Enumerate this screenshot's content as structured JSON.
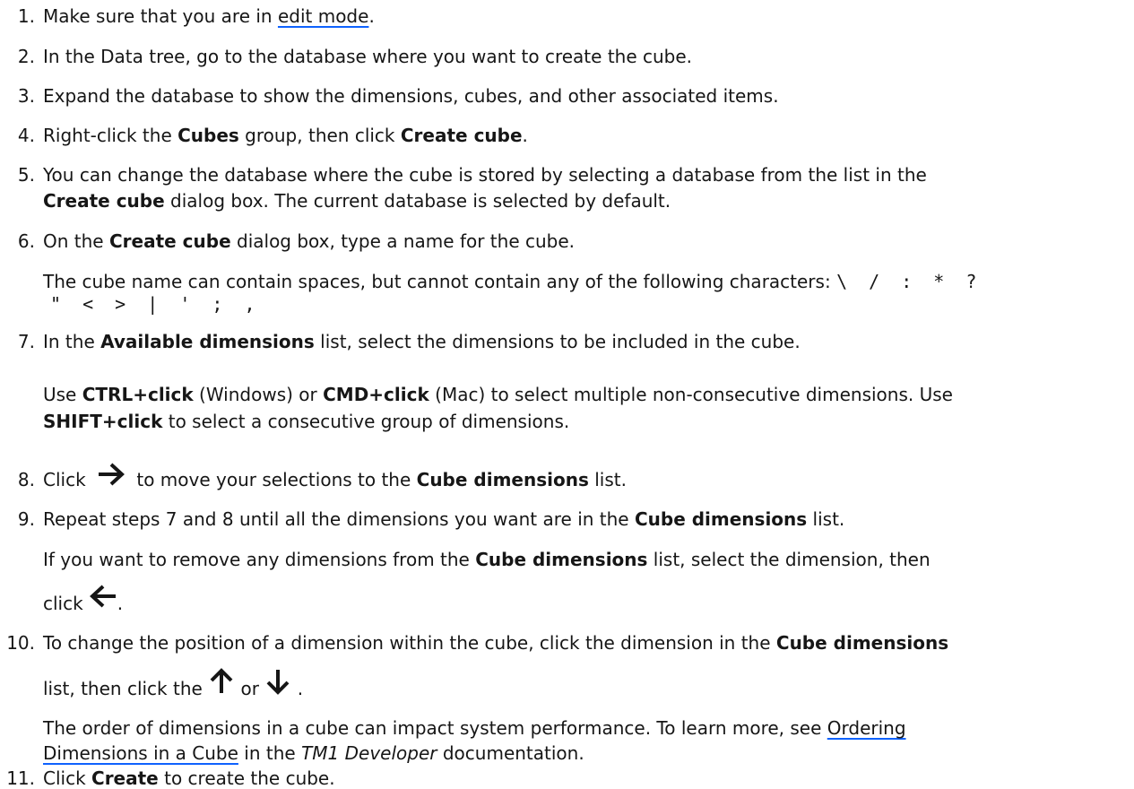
{
  "steps": [
    {
      "num": "1.",
      "pre": "Make sure that you are in ",
      "link": "edit mode",
      "post": "."
    },
    {
      "num": "2.",
      "text": "In the Data tree, go to the database where you want to create the cube."
    },
    {
      "num": "3.",
      "text": "Expand the database to show the dimensions, cubes, and other associated items."
    },
    {
      "num": "4.",
      "a": "Right-click the ",
      "b1": "Cubes",
      "c": " group, then click ",
      "b2": "Create cube",
      "d": "."
    },
    {
      "num": "5.",
      "line1": "You can change the database where the cube is stored by selecting a database from the list in the",
      "b1": "Create cube",
      "line2": " dialog box. The current database is selected by default."
    },
    {
      "num": "6.",
      "a": "On the ",
      "b1": "Create cube",
      "c": " dialog box, type a name for the cube.",
      "note_line1": "The cube name can contain spaces, but cannot contain any of the following characters: ",
      "note_chars1": "\\ / : * ?",
      "note_chars2": "\" < > | ' ; ,"
    },
    {
      "num": "7.",
      "a": "In the ",
      "b1": "Available dimensions",
      "c": " list, select the dimensions to be included in the cube.",
      "p_use": "Use ",
      "p_b1": "CTRL+click",
      "p_win": " (Windows) or ",
      "p_b2": "CMD+click",
      "p_rest": " (Mac) to select multiple non-consecutive dimensions. Use",
      "p_b3": "SHIFT+click",
      "p_end": " to select a consecutive group of dimensions."
    },
    {
      "num": "8.",
      "a": "Click ",
      "icon": "arrow-right-icon",
      "c": " to move your selections to the ",
      "b1": "Cube dimensions",
      "d": " list."
    },
    {
      "num": "9.",
      "a": "Repeat steps 7 and 8 until all the dimensions you want are in the ",
      "b1": "Cube dimensions",
      "d": " list.",
      "p_a": "If you want to remove any dimensions from the ",
      "p_b1": "Cube dimensions",
      "p_c": " list, select the dimension, then",
      "p_click": "click",
      "p_icon": "arrow-left-icon",
      "p_end": "."
    },
    {
      "num": "10.",
      "a": "To change the position of a dimension within the cube, click the dimension in the ",
      "b1": "Cube dimensions",
      "l2a": "list, then click the ",
      "icon_up": "arrow-up-icon",
      "or": " or ",
      "icon_down": "arrow-down-icon",
      "l2end": " .",
      "p_a": "The order of dimensions in a cube can impact system performance. To learn more, see ",
      "p_link1": "Ordering",
      "p_link2": "Dimensions in a Cube",
      "p_b": " in the ",
      "p_i": "TM1 Developer",
      "p_c": " documentation."
    },
    {
      "num": "11.",
      "a": "Click ",
      "b1": "Create",
      "c": " to create the cube."
    }
  ]
}
